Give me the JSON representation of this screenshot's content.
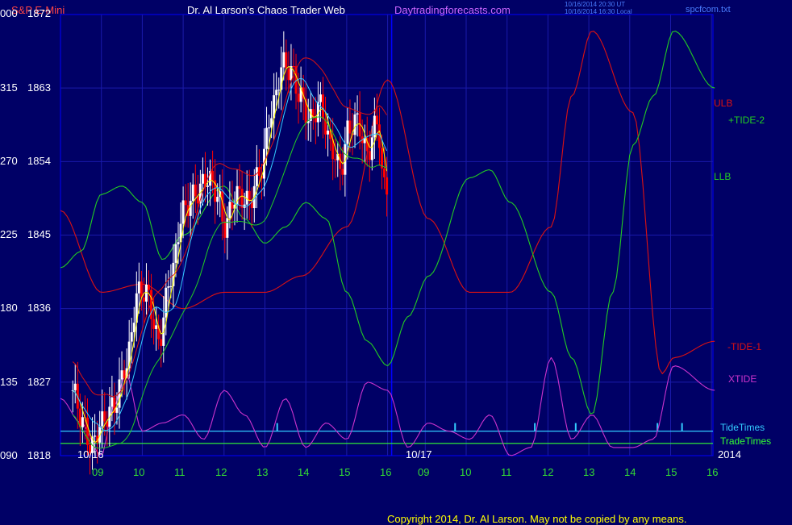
{
  "header": {
    "symbol": "S&P E-Mini",
    "title": "Dr. Al Larson's Chaos Trader Web",
    "site": "Daytradingforecasts.com",
    "timestamp_line1": "10/16/2014 20:30 UT",
    "timestamp_line2": "10/16/2014 16:30 Local",
    "file": "spcfcom.txt"
  },
  "footer": {
    "copyright": "Copyright 2014, Dr. Al Larson. May not be copied by any means."
  },
  "colors": {
    "background": "#000066",
    "grid_frame": "#0000ff",
    "axis_white": "#ffffff",
    "price_up": "#ffffff",
    "price_down": "#ff0000",
    "ulb": "#dd1111",
    "llb": "#22cc22",
    "tide2": "#22cc22",
    "tide1": "#dd1111",
    "xtide": "#cc33cc",
    "ma_yellow": "#ffff00",
    "ma_cyan": "#33ccff",
    "tidetimes": "#33ccff",
    "tradetimes": "#33ff33"
  },
  "chart_data": {
    "type": "line",
    "title": "S&P E-Mini",
    "y_left_inner_ticks": [
      "000",
      "315",
      "270",
      "225",
      "180",
      "135",
      "090"
    ],
    "y_left_price_ticks": [
      "1872",
      "1863",
      "1854",
      "1845",
      "1836",
      "1827",
      "1818"
    ],
    "ylim": [
      1818,
      1872
    ],
    "x_tick_labels": [
      "09",
      "10",
      "11",
      "12",
      "13",
      "14",
      "15",
      "16",
      "09",
      "10",
      "11",
      "12",
      "13",
      "14",
      "15",
      "16"
    ],
    "date_labels": [
      "10/16",
      "10/17"
    ],
    "year_label": "2014",
    "legend_right": [
      "ULB",
      "+TIDE-2",
      "LLB",
      "-TIDE-1",
      "XTIDE",
      "TideTimes",
      "TradeTimes"
    ],
    "ohlc_keypoints": {
      "x_hours": [
        8.3,
        8.55,
        8.75,
        9.0,
        9.3,
        9.6,
        9.9,
        10.1,
        10.4,
        10.7,
        11.0,
        11.3,
        11.6,
        11.85,
        12.0,
        12.3,
        12.6,
        12.9,
        13.15,
        13.45,
        13.65,
        13.85,
        14.1,
        14.35,
        14.6,
        14.85,
        15.05,
        15.25,
        15.5,
        15.75,
        15.9,
        16.0
      ],
      "close": [
        1826,
        1822,
        1819,
        1822,
        1824,
        1829,
        1838,
        1838,
        1832,
        1840,
        1848,
        1850,
        1852,
        1850,
        1846,
        1850,
        1849,
        1853,
        1860,
        1866,
        1865,
        1862,
        1859,
        1861,
        1856,
        1853,
        1858,
        1859,
        1855,
        1859,
        1851,
        1851
      ]
    },
    "ulb_daywise_shape": {
      "x_hours": [
        8.0,
        9.0,
        10.0,
        11.0,
        12.0,
        13.0,
        13.9,
        15.0,
        16.0,
        17.0,
        18.0,
        19.0,
        20.0,
        20.5,
        21.0,
        22.0,
        22.7,
        23.0,
        24.0
      ],
      "values": [
        1848,
        1838,
        1839,
        1836,
        1838,
        1838,
        1840,
        1846,
        1864,
        1847,
        1838,
        1838,
        1846,
        1862,
        1870,
        1860,
        1828,
        1830,
        1832
      ]
    },
    "tide2_daywise_shape": {
      "x_hours": [
        8.0,
        8.5,
        9.0,
        9.5,
        10.0,
        10.5,
        11.0,
        12.0,
        12.5,
        13.0,
        13.5,
        14.0,
        14.5,
        15.0,
        15.5,
        16.0,
        16.5,
        17.0,
        18.0,
        18.5,
        19.0,
        20.0,
        20.5,
        21.0,
        21.5,
        22.0,
        22.5,
        23.0,
        24.0
      ],
      "values": [
        1841,
        1843,
        1850,
        1851,
        1849,
        1842,
        1845,
        1851,
        1847,
        1844,
        1846,
        1849,
        1847,
        1838,
        1832,
        1829,
        1835,
        1840,
        1852,
        1853,
        1849,
        1838,
        1830,
        1823,
        1838,
        1856,
        1862,
        1870,
        1863
      ]
    },
    "xtide_shape": {
      "x_hours": [
        8.0,
        8.5,
        9.0,
        9.3,
        9.6,
        10.0,
        10.5,
        11.0,
        11.5,
        12.0,
        12.5,
        13.0,
        13.5,
        14.0,
        14.5,
        15.0,
        15.5,
        16.0,
        16.5,
        17.0,
        17.5,
        18.0,
        18.5,
        19.0,
        19.5,
        20.0,
        20.5,
        21.0,
        21.5,
        22.0,
        22.5,
        23.0,
        24.0
      ],
      "values": [
        1825,
        1822,
        1818,
        1824,
        1828,
        1821,
        1822,
        1823,
        1820,
        1826,
        1823,
        1819,
        1825,
        1819,
        1822,
        1820,
        1827,
        1826,
        1819,
        1822,
        1821,
        1820,
        1823,
        1818,
        1819,
        1830,
        1820,
        1823,
        1819,
        1819,
        1820,
        1829,
        1826
      ]
    },
    "tidetimes_level": 1821,
    "tradetimes_level": 1819.5,
    "grid": true,
    "legend_placement": "right"
  }
}
